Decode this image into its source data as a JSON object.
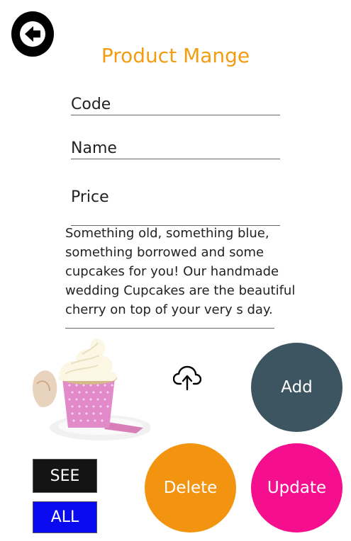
{
  "header": {
    "title": "Product Mange",
    "back_icon": "arrow-left-circle-icon"
  },
  "form": {
    "code_placeholder": "Code",
    "name_placeholder": "Name",
    "price_placeholder": "Price",
    "description": "Something old, something blue,\n something borrowed and some\n cupcakes for you! Our handmade\n wedding Cupcakes are the beautiful\ncherry on top of your very s day."
  },
  "media": {
    "image_alt": "cupcake",
    "upload_icon": "cloud-upload-icon"
  },
  "actions": {
    "add_label": "Add",
    "delete_label": "Delete",
    "update_label": "Update",
    "see_label": "SEE",
    "all_label": "ALL"
  },
  "colors": {
    "title": "#f39c12",
    "add": "#3d5561",
    "delete": "#f39411",
    "update": "#f50e8d",
    "see": "#141414",
    "all": "#0a0af0"
  }
}
